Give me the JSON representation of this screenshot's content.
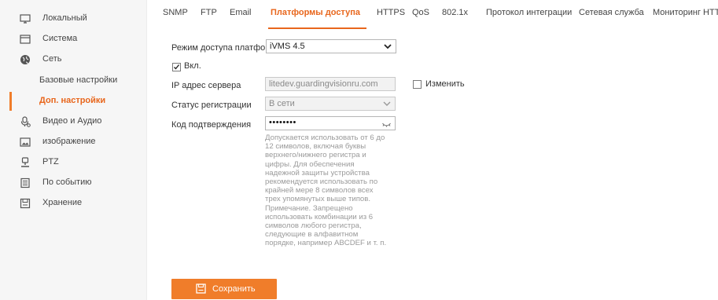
{
  "sidebar": {
    "items": [
      {
        "label": "Локальный",
        "icon": "monitor-icon"
      },
      {
        "label": "Система",
        "icon": "window-icon"
      },
      {
        "label": "Сеть",
        "icon": "globe-icon"
      },
      {
        "label": "Базовые настройки"
      },
      {
        "label": "Доп. настройки"
      },
      {
        "label": "Видео и Аудио",
        "icon": "mic-icon"
      },
      {
        "label": "изображение",
        "icon": "image-icon"
      },
      {
        "label": "PTZ",
        "icon": "ptz-icon"
      },
      {
        "label": "По событию",
        "icon": "event-icon"
      },
      {
        "label": "Хранение",
        "icon": "storage-icon"
      }
    ],
    "active_color": "#e8661c"
  },
  "tabs": [
    {
      "label": "SNMP"
    },
    {
      "label": "FTP"
    },
    {
      "label": "Email"
    },
    {
      "label": "Платформы доступа"
    },
    {
      "label": "HTTPS"
    },
    {
      "label": "QoS"
    },
    {
      "label": "802.1x"
    },
    {
      "label": "Протокол интеграции"
    },
    {
      "label": "Сетевая служба"
    },
    {
      "label": "Мониторинг HTTP"
    }
  ],
  "form": {
    "mode_label": "Режим доступа платфор...",
    "mode_value": "iVMS 4.5",
    "enable_label": "Вкл.",
    "enable_checked": true,
    "server_label": "IP адрес сервера",
    "server_value": "litedev.guardingvisionru.com",
    "change_label": "Изменить",
    "change_checked": false,
    "status_label": "Статус регистрации",
    "status_value": "В сети",
    "code_label": "Код подтверждения",
    "code_value": "••••••••",
    "hint_lines": [
      "Допускается использовать от 6 до",
      "12 символов, включая буквы",
      "верхнего/нижнего регистра и",
      "цифры. Для обеспечения",
      "надежной защиты устройства",
      "рекомендуется использовать по",
      "крайней мере 8 символов всех",
      "трех упомянутых выше типов.",
      "Примечание. Запрещено",
      "использовать комбинации из 6",
      "символов любого регистра,",
      "следующие в алфавитном",
      "порядке, например ABCDEF и т. п."
    ]
  },
  "save_button": {
    "label": "Сохранить",
    "color": "#f07d2a"
  }
}
